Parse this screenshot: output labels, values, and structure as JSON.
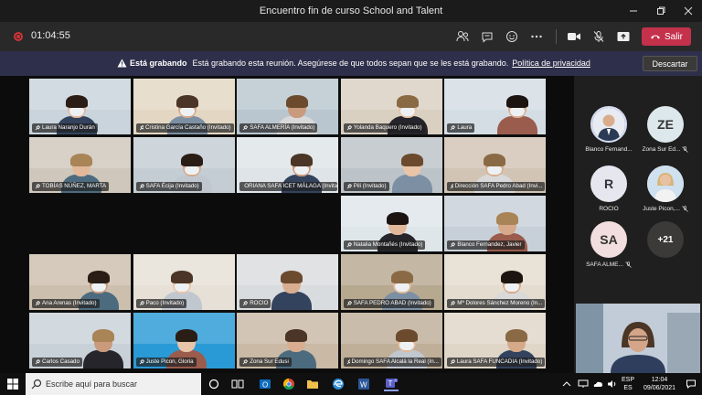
{
  "window": {
    "title": "Encuentro fin de curso School and Talent"
  },
  "toolbar": {
    "timer": "01:04:55",
    "leave_label": "Salir",
    "icons": [
      "participants-icon",
      "chat-icon",
      "reactions-icon",
      "more-icon",
      "camera-icon",
      "mic-off-icon",
      "share-icon"
    ]
  },
  "banner": {
    "title": "Está grabando",
    "message": "Está grabando esta reunión. Asegúrese de que todos sepan que se les está grabando.",
    "link": "Política de privacidad",
    "dismiss": "Descartar"
  },
  "participants": [
    {
      "name": "Laura Naranjo Durán"
    },
    {
      "name": "Cristina García Castaño (Invitado)"
    },
    {
      "name": "SAFA ALMERÍA (Invitado)"
    },
    {
      "name": "Yolanda Baquero (Invitado)"
    },
    {
      "name": "Laura"
    },
    {
      "name": "TOBÍAS NÚÑEZ, MARTA"
    },
    {
      "name": "SAFA Écija (Invitado)"
    },
    {
      "name": "ORIANA SAFA ICET MÁLAGA (Invitado)"
    },
    {
      "name": "Pili (Invitado)"
    },
    {
      "name": "Dirección SAFA Pedro Abad (Invi..."
    },
    {
      "name": "Natalia Montañés (Invitado)"
    },
    {
      "name": "Blanco Fernandez, Javier"
    },
    {
      "name": "Ana Arenas (Invitado)"
    },
    {
      "name": "Paco (Invitado)"
    },
    {
      "name": "ROCIO"
    },
    {
      "name": "SAFA PEDRO ABAD (Invitado)"
    },
    {
      "name": "Mª Dolores Sánchez Moreno (In..."
    },
    {
      "name": "Carlos Casado"
    },
    {
      "name": "Juste Picon, Gloria"
    },
    {
      "name": "Zona Sur Edusi"
    },
    {
      "name": "Domingo SAFA Alcalá la Real (In..."
    },
    {
      "name": "Laura SAFA FUNCADIA (Invitado)"
    }
  ],
  "side_panel": {
    "people": [
      {
        "name": "Blanco Fernand...",
        "initials": "",
        "muted": false
      },
      {
        "name": "Zona Sur Ed...",
        "initials": "ZE",
        "muted": true
      },
      {
        "name": "ROCIO",
        "initials": "R",
        "muted": false
      },
      {
        "name": "Juste Picon,...",
        "initials": "",
        "muted": true
      },
      {
        "name": "SAFA ALME...",
        "initials": "SA",
        "muted": true
      }
    ],
    "more_count": "+21"
  },
  "taskbar": {
    "search_placeholder": "Escribe aquí para buscar",
    "lang_top": "ESP",
    "lang_bottom": "ES",
    "time": "12:04",
    "date": "09/06/2021"
  }
}
